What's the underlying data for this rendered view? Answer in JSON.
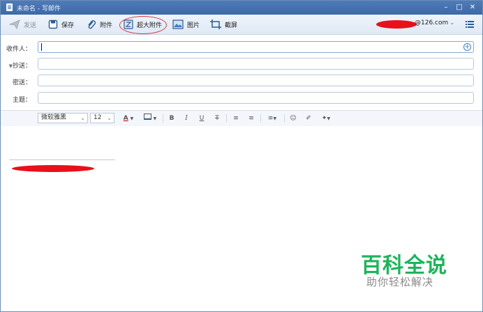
{
  "window": {
    "title": "未命名 - 写邮件",
    "controls": [
      "minimize",
      "maximize",
      "close"
    ]
  },
  "toolbar": {
    "send_label": "发送",
    "save_label": "保存",
    "attach_label": "附件",
    "large_attach_label": "超大附件",
    "image_label": "图片",
    "screenshot_label": "截屏",
    "account_label": "@126.com",
    "icons": [
      "send-icon",
      "save-icon",
      "paperclip-icon",
      "large-attachment-icon",
      "image-icon",
      "screenshot-icon",
      "menu-icon"
    ]
  },
  "fields": {
    "to_label": "收件人：",
    "cc_label": "抄送：",
    "bcc_label": "密送：",
    "subject_label": "主题：",
    "to_value": "",
    "cc_value": "",
    "bcc_value": "",
    "subject_value": ""
  },
  "format": {
    "font_family": "微软雅黑",
    "font_size": "12",
    "bold": "B",
    "italic": "I",
    "underline": "U",
    "strike": "T"
  },
  "watermark": {
    "title": "百科全说",
    "subtitle": "助你轻松解决"
  },
  "colors": {
    "titlebar": "#3d6aa8",
    "accent_ring": "#d63a3a",
    "watermark_green": "#1db45a",
    "redaction": "#e8101a"
  }
}
